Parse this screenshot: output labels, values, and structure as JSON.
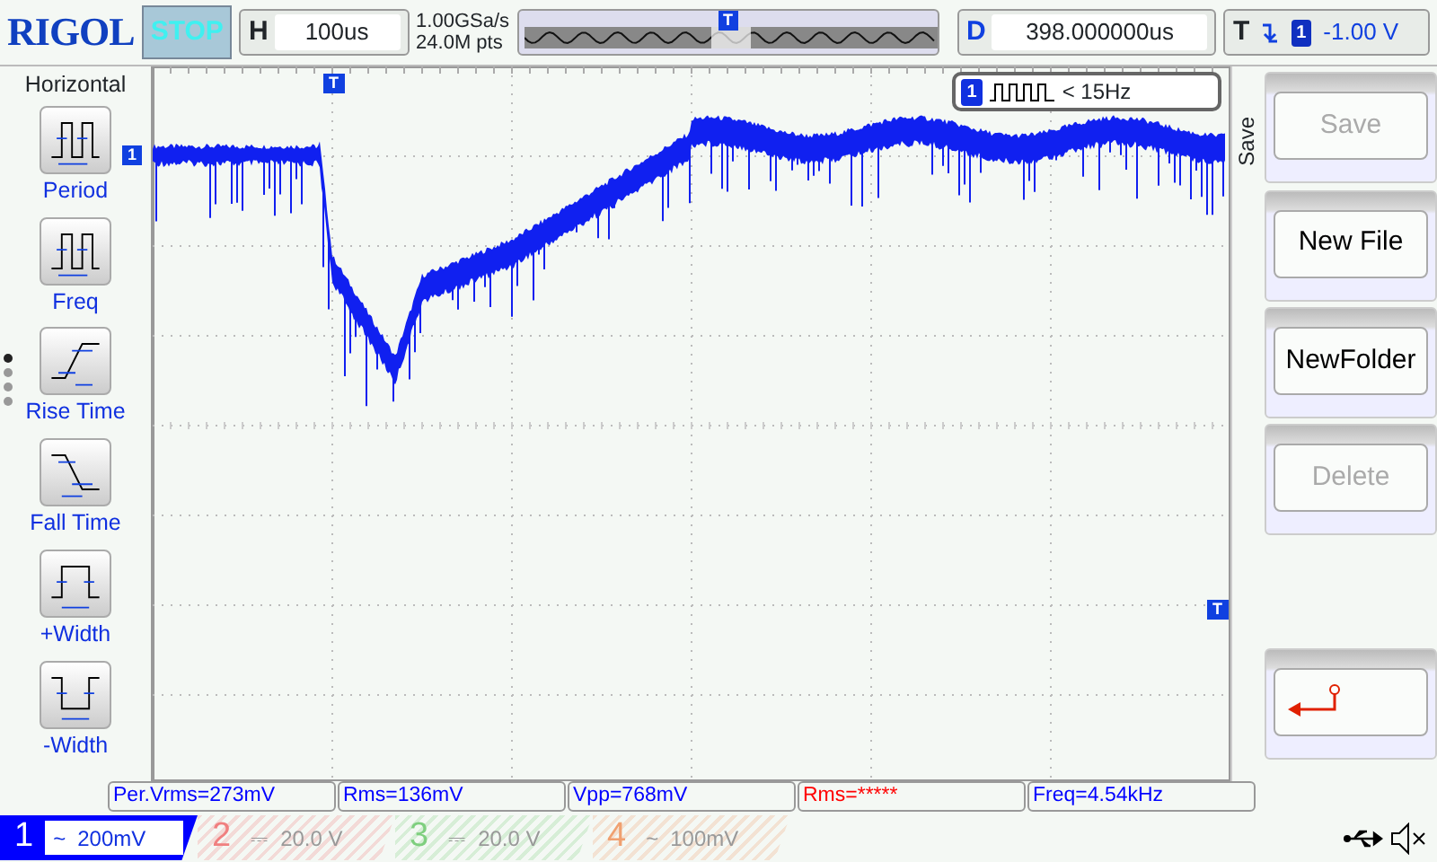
{
  "brand": "RIGOL",
  "run_state": "STOP",
  "horizontal": {
    "label": "H",
    "timebase": "100us",
    "sample_rate": "1.00GSa/s",
    "memory_depth": "24.0M pts"
  },
  "delay": {
    "label": "D",
    "value": "398.000000us"
  },
  "trigger": {
    "label": "T",
    "source": "1",
    "level": "-1.00 V"
  },
  "memory_bar": {
    "trigger_marker": "T"
  },
  "left_menu": {
    "title": "Horizontal",
    "pages": [
      {
        "selected": true
      },
      {
        "selected": false
      },
      {
        "selected": false
      },
      {
        "selected": false
      }
    ],
    "items": [
      {
        "kind": "period",
        "label": "Period"
      },
      {
        "kind": "freq",
        "label": "Freq"
      },
      {
        "kind": "rise",
        "label": "Rise Time"
      },
      {
        "kind": "fall",
        "label": "Fall Time"
      },
      {
        "kind": "pwidth",
        "label": "+Width"
      },
      {
        "kind": "nwidth",
        "label": "-Width"
      }
    ]
  },
  "plot": {
    "channel_marker": "1",
    "trigger_position_marker": "T",
    "trigger_level_marker": "T",
    "trigger_status": {
      "source": "1",
      "text": "< 15Hz"
    }
  },
  "right_menu": {
    "title": "Save",
    "buttons": [
      {
        "kind": "text",
        "label": "Save",
        "disabled": true
      },
      {
        "kind": "text",
        "label": "New File",
        "disabled": false
      },
      {
        "kind": "text",
        "label": "NewFolder",
        "disabled": false
      },
      {
        "kind": "text",
        "label": "Delete",
        "disabled": true
      },
      {
        "kind": "return"
      }
    ]
  },
  "measurements": [
    {
      "text": "Per.Vrms=273mV",
      "color": "#0000ff"
    },
    {
      "text": "Rms=136mV",
      "color": "#0000ff"
    },
    {
      "text": "Vpp=768mV",
      "color": "#0000ff"
    },
    {
      "text": "Rms=*****",
      "color": "#ff0000"
    },
    {
      "text": "Freq=4.54kHz",
      "color": "#0000ff"
    }
  ],
  "channels": [
    {
      "number": "1",
      "coupling": "~",
      "scale": "200mV",
      "on": true,
      "color": "#0000ff"
    },
    {
      "number": "2",
      "coupling": "⎓",
      "scale": "20.0 V",
      "on": false,
      "color": "#f08080"
    },
    {
      "number": "3",
      "coupling": "⎓",
      "scale": "20.0 V",
      "on": false,
      "color": "#7fcf7f"
    },
    {
      "number": "4",
      "coupling": "~",
      "scale": "100mV",
      "on": false,
      "color": "#f0a070"
    }
  ]
}
